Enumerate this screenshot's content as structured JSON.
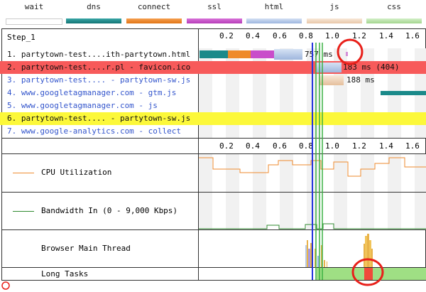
{
  "legend": [
    {
      "label": "wait",
      "color": "#ffffff"
    },
    {
      "label": "dns",
      "color": "#1b8a8a"
    },
    {
      "label": "connect",
      "color": "#ef8a2a"
    },
    {
      "label": "ssl",
      "color": "#c94dca"
    },
    {
      "label": "html",
      "color": "#b8cbe8"
    },
    {
      "label": "js",
      "color": "#f2d9c2"
    },
    {
      "label": "css",
      "color": "#b9e2aa"
    }
  ],
  "step_title": "Step_1",
  "axis_ticks": [
    "0.2",
    "0.4",
    "0.6",
    "0.8",
    "1.0",
    "1.2",
    "1.4",
    "1.6"
  ],
  "requests": [
    {
      "label": "1. partytown-test....ith-partytown.html",
      "timing": "757 ms",
      "link": false,
      "highlight": ""
    },
    {
      "label": "2. partytown-test....r.pl - favicon.ico",
      "timing": "183 ms (404)",
      "link": false,
      "highlight": "red"
    },
    {
      "label": "3. partytown-test.... - partytown-sw.js",
      "timing": "188 ms",
      "link": true,
      "highlight": ""
    },
    {
      "label": "4. www.googletagmanager.com - gtm.js",
      "timing": "",
      "link": true,
      "highlight": ""
    },
    {
      "label": "5. www.googletagmanager.com - js",
      "timing": "",
      "link": true,
      "highlight": ""
    },
    {
      "label": "6. partytown-test.... - partytown-sw.js",
      "timing": "",
      "link": false,
      "highlight": "yellow"
    },
    {
      "label": "7. www.google-analytics.com - collect",
      "timing": "",
      "link": true,
      "highlight": ""
    }
  ],
  "metrics": {
    "cpu_label": "CPU Utilization",
    "bandwidth_label": "Bandwidth In (0 - 9,000 Kbps)",
    "main_thread_label": "Browser Main Thread",
    "long_tasks_label": "Long Tasks"
  },
  "colors": {
    "row_red": "#f75a5a",
    "row_yellow": "#fcf83a",
    "link": "#3355cc",
    "cpu_line": "#ee8a2e",
    "bw_line": "#2f8a2f",
    "long_ok": "#9fdf84",
    "long_bad": "#f04a3a",
    "annotation": "#e8201a"
  }
}
